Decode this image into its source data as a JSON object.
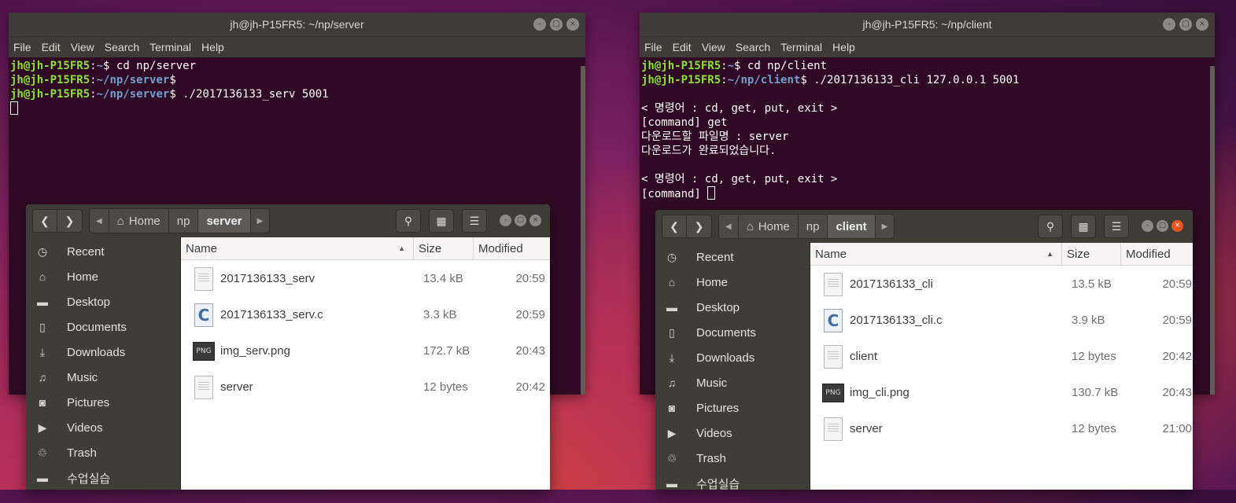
{
  "left_terminal": {
    "title": "jh@jh-P15FR5: ~/np/server",
    "menu": [
      "File",
      "Edit",
      "View",
      "Search",
      "Terminal",
      "Help"
    ],
    "lines": [
      {
        "user": "jh@jh-P15FR5",
        "path": "~",
        "cmd": "$ cd np/server"
      },
      {
        "user": "jh@jh-P15FR5",
        "path": "~/np/server",
        "cmd": "$"
      },
      {
        "user": "jh@jh-P15FR5",
        "path": "~/np/server",
        "cmd": "$ ./2017136133_serv 5001"
      }
    ]
  },
  "right_terminal": {
    "title": "jh@jh-P15FR5: ~/np/client",
    "menu": [
      "File",
      "Edit",
      "View",
      "Search",
      "Terminal",
      "Help"
    ],
    "lines": [
      {
        "user": "jh@jh-P15FR5",
        "path": "~",
        "cmd": "$ cd np/client"
      },
      {
        "user": "jh@jh-P15FR5",
        "path": "~/np/client",
        "cmd": "$ ./2017136133_cli 127.0.0.1 5001"
      }
    ],
    "output": [
      "",
      "< 명령어 : cd, get, put, exit >",
      "[command] get",
      "다운로드할 파일명 : server",
      "다운로드가 완료되었습니다.",
      "",
      "< 명령어 : cd, get, put, exit >",
      "[command] "
    ]
  },
  "left_files": {
    "path": [
      "Home",
      "np",
      "server"
    ],
    "sidebar": [
      {
        "icon": "clock-icon",
        "glyph": "◷",
        "label": "Recent"
      },
      {
        "icon": "home-icon",
        "glyph": "⌂",
        "label": "Home"
      },
      {
        "icon": "folder-icon",
        "glyph": "▬",
        "label": "Desktop"
      },
      {
        "icon": "document-icon",
        "glyph": "▯",
        "label": "Documents"
      },
      {
        "icon": "download-icon",
        "glyph": "⤓",
        "label": "Downloads"
      },
      {
        "icon": "music-icon",
        "glyph": "♫",
        "label": "Music"
      },
      {
        "icon": "camera-icon",
        "glyph": "◙",
        "label": "Pictures"
      },
      {
        "icon": "video-icon",
        "glyph": "▶",
        "label": "Videos"
      },
      {
        "icon": "trash-icon",
        "glyph": "♲",
        "label": "Trash"
      },
      {
        "icon": "folder-icon",
        "glyph": "▬",
        "label": "수업실습"
      }
    ],
    "columns": {
      "name": "Name",
      "size": "Size",
      "modified": "Modified"
    },
    "files": [
      {
        "type": "doc",
        "name": "2017136133_serv",
        "size": "13.4 kB",
        "modified": "20:59"
      },
      {
        "type": "c",
        "name": "2017136133_serv.c",
        "size": "3.3 kB",
        "modified": "20:59"
      },
      {
        "type": "png",
        "name": "img_serv.png",
        "size": "172.7 kB",
        "modified": "20:43"
      },
      {
        "type": "doc",
        "name": "server",
        "size": "12 bytes",
        "modified": "20:42"
      }
    ]
  },
  "right_files": {
    "path": [
      "Home",
      "np",
      "client"
    ],
    "sidebar": [
      {
        "icon": "clock-icon",
        "glyph": "◷",
        "label": "Recent"
      },
      {
        "icon": "home-icon",
        "glyph": "⌂",
        "label": "Home"
      },
      {
        "icon": "folder-icon",
        "glyph": "▬",
        "label": "Desktop"
      },
      {
        "icon": "document-icon",
        "glyph": "▯",
        "label": "Documents"
      },
      {
        "icon": "download-icon",
        "glyph": "⤓",
        "label": "Downloads"
      },
      {
        "icon": "music-icon",
        "glyph": "♫",
        "label": "Music"
      },
      {
        "icon": "camera-icon",
        "glyph": "◙",
        "label": "Pictures"
      },
      {
        "icon": "video-icon",
        "glyph": "▶",
        "label": "Videos"
      },
      {
        "icon": "trash-icon",
        "glyph": "♲",
        "label": "Trash"
      },
      {
        "icon": "folder-icon",
        "glyph": "▬",
        "label": "수업실습"
      }
    ],
    "columns": {
      "name": "Name",
      "size": "Size",
      "modified": "Modified"
    },
    "files": [
      {
        "type": "doc",
        "name": "2017136133_cli",
        "size": "13.5 kB",
        "modified": "20:59"
      },
      {
        "type": "c",
        "name": "2017136133_cli.c",
        "size": "3.9 kB",
        "modified": "20:59"
      },
      {
        "type": "doc",
        "name": "client",
        "size": "12 bytes",
        "modified": "20:42"
      },
      {
        "type": "png",
        "name": "img_cli.png",
        "size": "130.7 kB",
        "modified": "20:43"
      },
      {
        "type": "doc",
        "name": "server",
        "size": "12 bytes",
        "modified": "21:00"
      }
    ]
  },
  "icons": {
    "c_glyph": "C",
    "png_glyph": "PNG"
  },
  "colors": {
    "terminal_bg": "#300a24",
    "prompt_user": "#8ae234",
    "prompt_path": "#729fcf",
    "ubuntu_orange": "#e95420"
  }
}
